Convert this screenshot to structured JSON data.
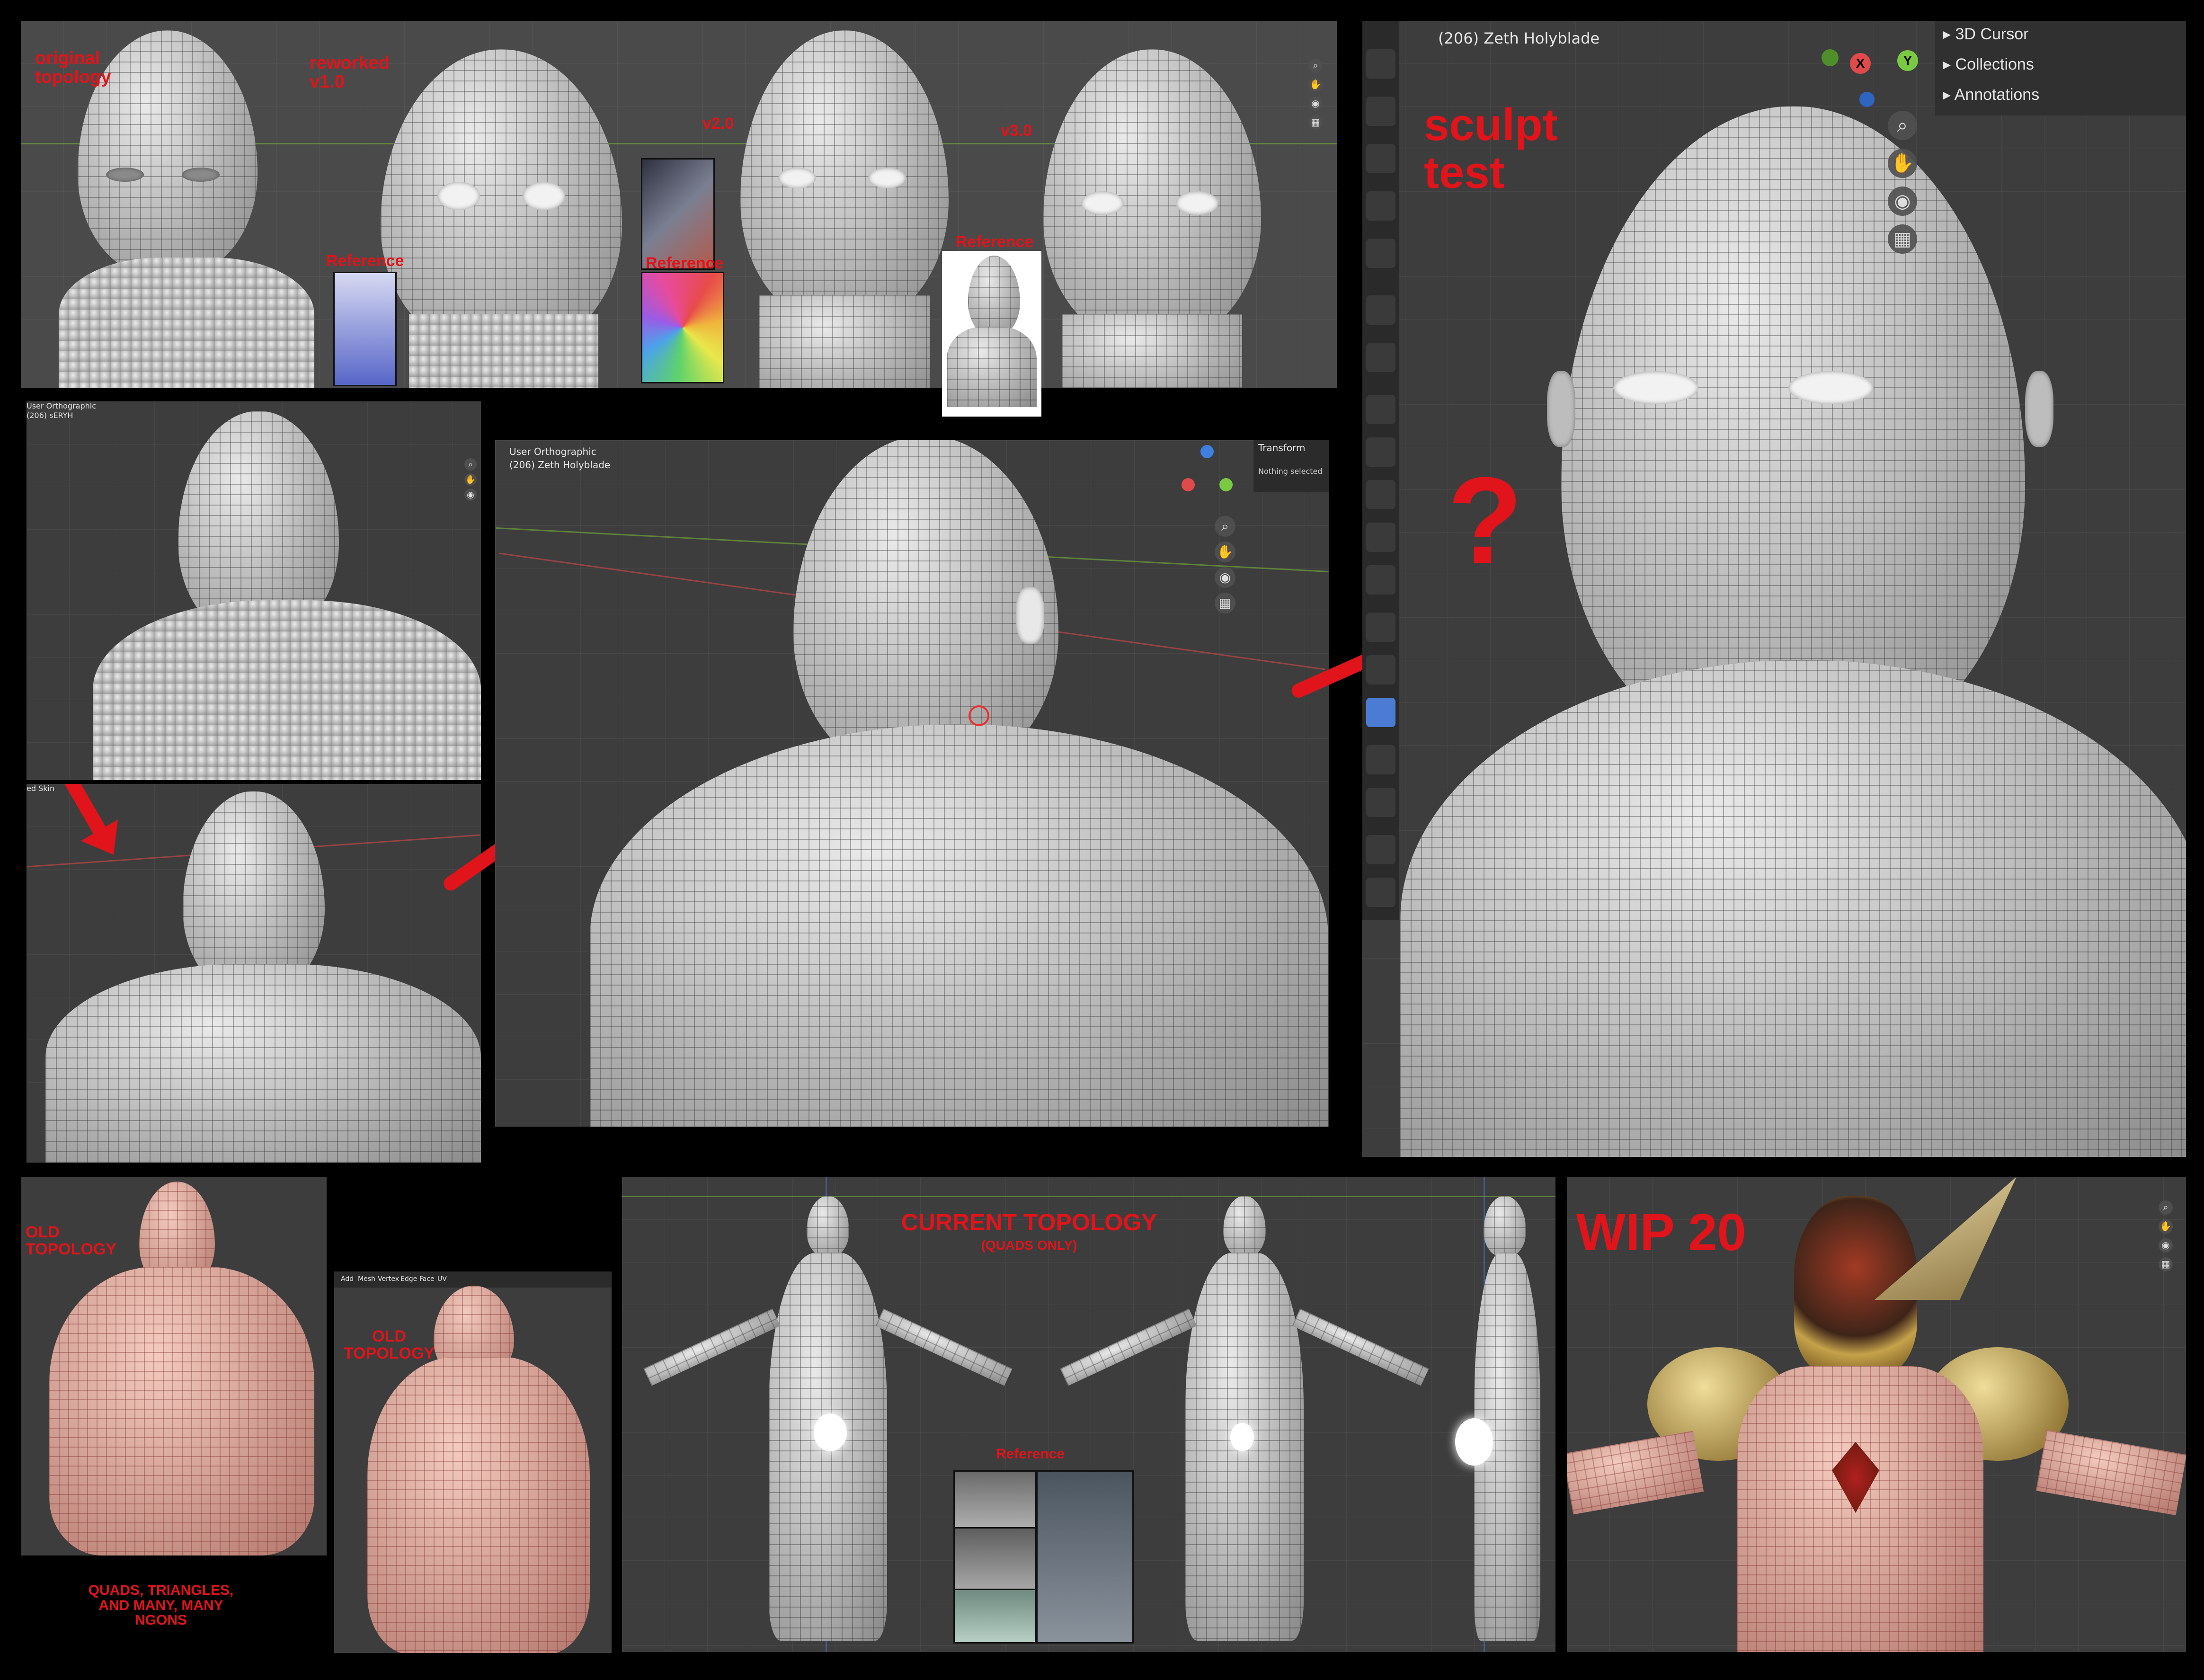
{
  "top_strip": {
    "labels": {
      "original": "original\ntopology",
      "reworked": "reworked\nv1.0",
      "v2": "v2.0",
      "v3": "v3.0",
      "reference_1": "Reference",
      "reference_2": "Reference",
      "reference_3": "Reference"
    }
  },
  "middle_left": {
    "top_view_label": "User Orthographic",
    "top_view_sub": "(206) sERYH",
    "bottom_view_label": "ed Skin"
  },
  "middle_center": {
    "view_label": "User Orthographic",
    "object_label": "(206) Zeth Holyblade",
    "transform_panel": "Transform",
    "nothing_selected": "Nothing selected"
  },
  "sculpt": {
    "object_label": "(206) Zeth Holyblade",
    "title": "sculpt\ntest",
    "question": "?",
    "outliner": [
      "3D Cursor",
      "Collections",
      "Annotations"
    ],
    "gizmo": {
      "x": "X",
      "y": "Y"
    }
  },
  "bottom": {
    "old_topology_1": "OLD\nTOPOLOGY",
    "old_topology_2": "OLD\nTOPOLOGY",
    "quads_note": "QUADS, TRIANGLES,\nAND MANY, MANY\nNGONS",
    "current_title": "CURRENT TOPOLOGY",
    "current_sub": "(QUADS ONLY)",
    "reference": "Reference",
    "menu": [
      "Add",
      "Mesh",
      "Vertex",
      "Edge",
      "Face",
      "UV"
    ],
    "wip": "WIP 20"
  },
  "colors": {
    "annotation_red": "#e0141a",
    "viewport_bg": "#3d3d3d",
    "mesh_grey": "#cfcfcf",
    "skin_pink": "#e7aa9a",
    "active_tool_blue": "#4b7bd2"
  }
}
